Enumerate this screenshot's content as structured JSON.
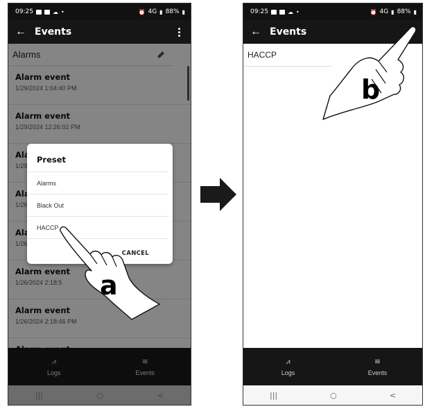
{
  "status_bar": {
    "time": "09:25",
    "network": "4G",
    "battery": "88%"
  },
  "screen_a": {
    "app_title": "Events",
    "preset_label": "Alarms",
    "events": [
      {
        "title": "Alarm event",
        "time": "1/29/2024 1:04:40 PM"
      },
      {
        "title": "Alarm event",
        "time": "1/29/2024 12:26:02 PM"
      },
      {
        "title": "Alarm event",
        "time": "1/29/2024"
      },
      {
        "title": "Alarm event",
        "time": "1/26/2024"
      },
      {
        "title": "Alarm event",
        "time": "1/26/2024"
      },
      {
        "title": "Alarm event",
        "time": "1/26/2024 2:18:5"
      },
      {
        "title": "Alarm event",
        "time": "1/26/2024 2:18:46 PM"
      },
      {
        "title": "Alarm event",
        "time": ""
      }
    ],
    "dialog": {
      "title": "Preset",
      "options": [
        "Alarms",
        "Black Out",
        "HACCP"
      ],
      "cancel": "CANCEL"
    },
    "nav": [
      {
        "label": "Logs",
        "icon": "trend-icon"
      },
      {
        "label": "Events",
        "icon": "list-icon"
      }
    ]
  },
  "screen_b": {
    "app_title": "Events",
    "preset_label": "HACCP",
    "nav": [
      {
        "label": "Logs",
        "icon": "trend-icon"
      },
      {
        "label": "Events",
        "icon": "list-icon"
      }
    ]
  },
  "system_nav": {
    "recents": "|||",
    "home": "○",
    "back": "<"
  },
  "callouts": {
    "a": "a",
    "b": "b"
  },
  "colors": {
    "appbar": "#161616",
    "overlay": "rgba(0,0,0,0.48)",
    "arrow": "#1a1a1a"
  }
}
